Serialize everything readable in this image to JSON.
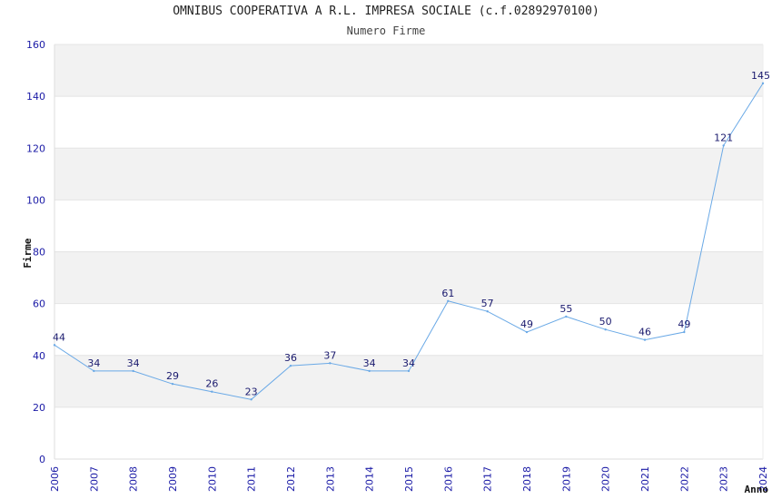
{
  "chart_data": {
    "type": "line",
    "title": "OMNIBUS COOPERATIVA A R.L. IMPRESA SOCIALE (c.f.02892970100)",
    "subtitle": "Numero Firme",
    "xlabel": "Anno",
    "ylabel": "Firme",
    "x": [
      "2006",
      "2007",
      "2008",
      "2009",
      "2010",
      "2011",
      "2012",
      "2013",
      "2014",
      "2015",
      "2016",
      "2017",
      "2018",
      "2019",
      "2020",
      "2021",
      "2022",
      "2023",
      "2024"
    ],
    "series": [
      {
        "values": [
          44,
          34,
          34,
          29,
          26,
          23,
          36,
          37,
          34,
          34,
          61,
          57,
          49,
          55,
          50,
          46,
          49,
          121,
          145
        ]
      }
    ],
    "ylim": [
      0,
      160
    ],
    "yticks": [
      0,
      20,
      40,
      60,
      80,
      100,
      120,
      140,
      160
    ],
    "grid": true,
    "band_colors": [
      "#f2f2f2",
      "#ffffff"
    ],
    "line_color": "#6aa9e6",
    "tick_color": "#1a1aa6"
  }
}
